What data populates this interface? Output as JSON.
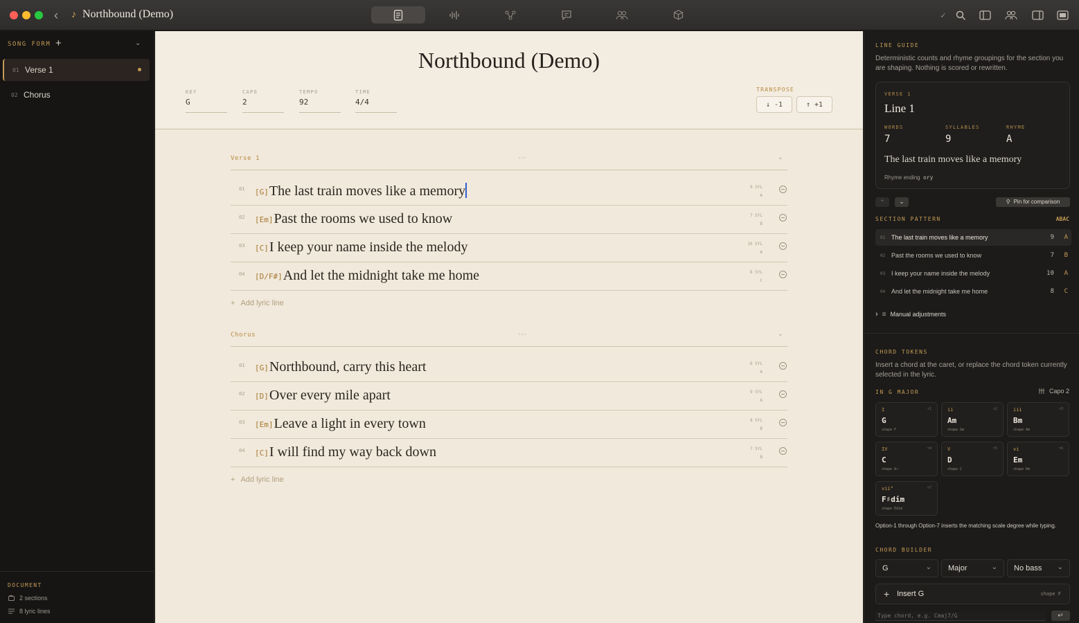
{
  "window": {
    "title": "Northbound (Demo)"
  },
  "toolbar": {
    "tabs": [
      {
        "icon": "document-icon",
        "active": true
      },
      {
        "icon": "waveform-icon",
        "active": false
      },
      {
        "icon": "branch-icon",
        "active": false
      },
      {
        "icon": "comment-icon",
        "active": false
      },
      {
        "icon": "people-icon",
        "active": false
      },
      {
        "icon": "package-icon",
        "active": false
      }
    ]
  },
  "sidebar": {
    "song_form_label": "SONG FORM",
    "items": [
      {
        "num": "01",
        "label": "Verse 1",
        "active": true
      },
      {
        "num": "02",
        "label": "Chorus",
        "active": false
      }
    ],
    "document": {
      "label": "DOCUMENT",
      "sections": "2 sections",
      "lyric_lines": "8 lyric lines"
    }
  },
  "song": {
    "title": "Northbound (Demo)",
    "meta": {
      "key": {
        "label": "KEY",
        "value": "G"
      },
      "capo": {
        "label": "CAPO",
        "value": "2"
      },
      "tempo": {
        "label": "TEMPO",
        "value": "92"
      },
      "time": {
        "label": "TIME",
        "value": "4/4"
      }
    },
    "transpose": {
      "label": "TRANSPOSE",
      "down": "↓ -1",
      "up": "↑ +1"
    },
    "add_line_label": "Add lyric line",
    "sections": [
      {
        "name": "Verse 1",
        "lines": [
          {
            "num": "01",
            "chord": "[G]",
            "text": "The last train moves like a memory",
            "syl": "9 SYL",
            "rhyme": "A"
          },
          {
            "num": "02",
            "chord": "[Em]",
            "text": "Past the rooms we used to know",
            "syl": "7 SYL",
            "rhyme": "B"
          },
          {
            "num": "03",
            "chord": "[C]",
            "text": "I keep your name inside the melody",
            "syl": "10 SYL",
            "rhyme": "A"
          },
          {
            "num": "04",
            "chord": "[D/F#]",
            "text": "And let the midnight take me home",
            "syl": "8 SYL",
            "rhyme": "C"
          }
        ]
      },
      {
        "name": "Chorus",
        "lines": [
          {
            "num": "01",
            "chord": "[G]",
            "text": "Northbound, carry this heart",
            "syl": "6 SYL",
            "rhyme": "A"
          },
          {
            "num": "02",
            "chord": "[D]",
            "text": "Over every mile apart",
            "syl": "9 SYL",
            "rhyme": "A"
          },
          {
            "num": "03",
            "chord": "[Em]",
            "text": "Leave a light in every town",
            "syl": "8 SYL",
            "rhyme": "B"
          },
          {
            "num": "04",
            "chord": "[C]",
            "text": "I will find my way back down",
            "syl": "7 SYL",
            "rhyme": "B"
          }
        ]
      }
    ]
  },
  "line_guide": {
    "title": "LINE GUIDE",
    "description": "Deterministic counts and rhyme groupings for the section you are shaping. Nothing is scored or rewritten.",
    "section_label": "VERSE 1",
    "line_label": "Line 1",
    "words_label": "WORDS",
    "words": "7",
    "syllables_label": "SYLLABLES",
    "syllables": "9",
    "rhyme_label": "RHYME",
    "rhyme": "A",
    "text": "The last train moves like a memory",
    "rhyme_ending_label": "Rhyme ending",
    "rhyme_ending": "ory",
    "pin_label": "Pin for comparison"
  },
  "section_pattern": {
    "title": "SECTION PATTERN",
    "pattern": "ABAC",
    "rows": [
      {
        "num": "01",
        "text": "The last train moves like a memory",
        "syl": "9",
        "rhyme": "A"
      },
      {
        "num": "02",
        "text": "Past the rooms we used to know",
        "syl": "7",
        "rhyme": "B"
      },
      {
        "num": "03",
        "text": "I keep your name inside the melody",
        "syl": "10",
        "rhyme": "A"
      },
      {
        "num": "04",
        "text": "And let the midnight take me home",
        "syl": "8",
        "rhyme": "C"
      }
    ],
    "manual_label": "Manual adjustments"
  },
  "chord_tokens": {
    "title": "CHORD TOKENS",
    "description": "Insert a chord at the caret, or replace the chord token currently selected in the lyric.",
    "key_label": "IN G MAJOR",
    "capo_label": "Capo 2",
    "chords": [
      {
        "deg": "I",
        "name": "G",
        "shape": "shape F",
        "key": "⌥1"
      },
      {
        "deg": "ii",
        "name": "Am",
        "shape": "shape Gm",
        "key": "⌥2"
      },
      {
        "deg": "iii",
        "name": "Bm",
        "shape": "shape Am",
        "key": "⌥3"
      },
      {
        "deg": "IV",
        "name": "C",
        "shape": "shape A♯",
        "key": "⌥4"
      },
      {
        "deg": "V",
        "name": "D",
        "shape": "shape C",
        "key": "⌥5"
      },
      {
        "deg": "vi",
        "name": "Em",
        "shape": "shape Dm",
        "key": "⌥6"
      },
      {
        "deg": "vii°",
        "name": "F♯dim",
        "shape": "shape Edim",
        "key": "⌥7"
      }
    ],
    "hint": "Option-1 through Option-7 inserts the matching scale degree while typing."
  },
  "chord_builder": {
    "title": "CHORD BUILDER",
    "root": "G",
    "quality": "Major",
    "bass": "No bass",
    "insert_label": "Insert G",
    "insert_shape": "shape F",
    "input_placeholder": "Type chord, e.g. Cmaj7/G"
  }
}
